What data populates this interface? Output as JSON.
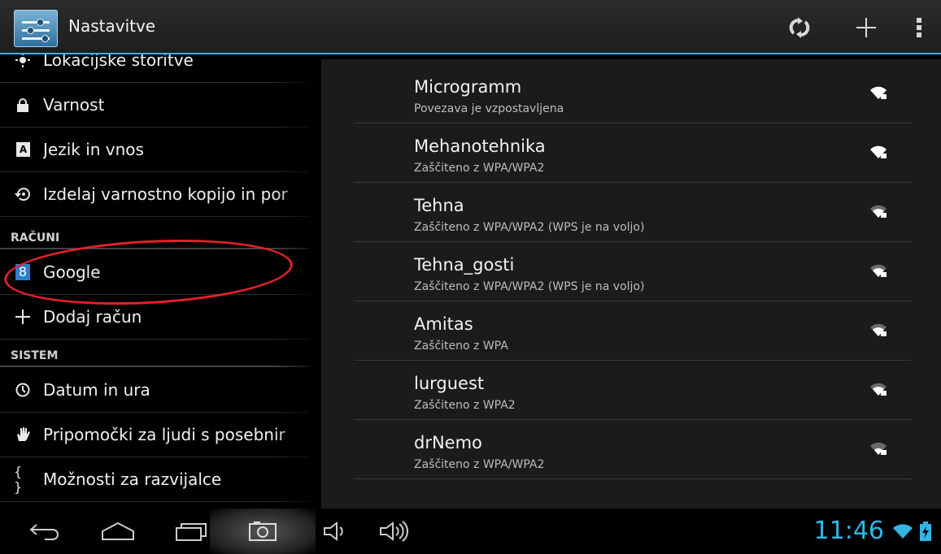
{
  "actionbar": {
    "title": "Nastavitve",
    "icons": [
      "settings-sliders-icon",
      "sync-icon",
      "add-icon",
      "overflow-menu-icon"
    ]
  },
  "left_menu": {
    "items_top": [
      {
        "label": "Lokacijske storitve",
        "icon": "location-icon"
      },
      {
        "label": "Varnost",
        "icon": "lock-icon"
      },
      {
        "label": "Jezik in vnos",
        "icon": "keyboard-a-icon"
      },
      {
        "label": "Izdelaj varnostno kopijo in por",
        "icon": "backup-restore-icon"
      }
    ],
    "section_accounts": "RAČUNI",
    "items_accounts": [
      {
        "label": "Google",
        "icon": "google-icon",
        "icon_glyph": "8"
      },
      {
        "label": "Dodaj račun",
        "icon": "plus-icon"
      }
    ],
    "section_system": "SISTEM",
    "items_system": [
      {
        "label": "Datum in ura",
        "icon": "clock-icon"
      },
      {
        "label": "Pripomočki za ljudi s posebnir",
        "icon": "hand-icon"
      },
      {
        "label": "Možnosti za razvijalce",
        "icon": "braces-icon",
        "icon_glyph": "{ }"
      }
    ]
  },
  "wifi_networks": [
    {
      "ssid": "Microgramm",
      "status": "Povezava je vzpostavljena"
    },
    {
      "ssid": "Mehanotehnika",
      "status": "Zaščiteno z WPA/WPA2"
    },
    {
      "ssid": "Tehna",
      "status": "Zaščiteno z WPA/WPA2 (WPS je na voljo)"
    },
    {
      "ssid": "Tehna_gosti",
      "status": "Zaščiteno z WPA/WPA2 (WPS je na voljo)"
    },
    {
      "ssid": "Amitas",
      "status": "Zaščiteno z WPA"
    },
    {
      "ssid": "lurguest",
      "status": "Zaščiteno z WPA2"
    },
    {
      "ssid": "drNemo",
      "status": "Zaščiteno z WPA/WPA2"
    }
  ],
  "system_bar": {
    "clock": "11:46",
    "nav_icons": [
      "back-icon",
      "home-icon",
      "recent-apps-icon",
      "screenshot-icon",
      "volume-down-icon",
      "volume-up-icon"
    ],
    "status_icons": [
      "wifi-status-icon",
      "battery-charging-icon"
    ]
  },
  "colors": {
    "accent": "#33b5e5",
    "annotation": "#e5202a"
  }
}
